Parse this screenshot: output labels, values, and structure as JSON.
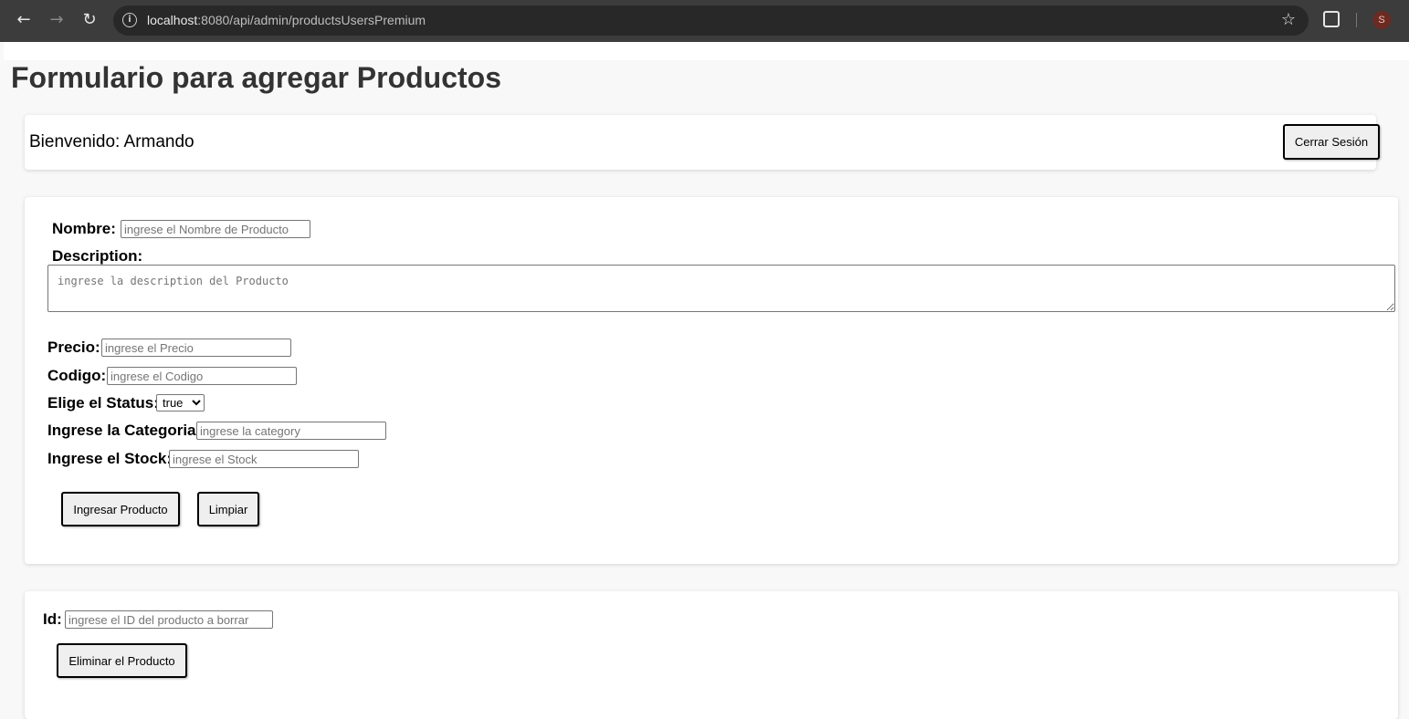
{
  "browser": {
    "url_host": "localhost",
    "url_rest": ":8080/api/admin/productsUsersPremium",
    "avatar_initial": "S"
  },
  "page": {
    "title": "Formulario para agregar Productos",
    "welcome": "Bienvenido: Armando",
    "logout_label": "Cerrar Sesión"
  },
  "form": {
    "nombre_label": "Nombre:",
    "nombre_placeholder": "ingrese el Nombre de Producto",
    "description_label": "Description:",
    "description_placeholder": "ingrese la description del Producto",
    "precio_label": "Precio:",
    "precio_placeholder": "ingrese el Precio",
    "codigo_label": "Codigo:",
    "codigo_placeholder": "ingrese el Codigo",
    "status_label": "Elige el Status:",
    "status_value": "true",
    "categoria_label": "Ingrese la Categoria:",
    "categoria_placeholder": "ingrese la category",
    "stock_label": "Ingrese el Stock:",
    "stock_placeholder": "ingrese el Stock",
    "submit_label": "Ingresar Producto",
    "clear_label": "Limpiar"
  },
  "delete": {
    "id_label": "Id:",
    "id_placeholder": "ingrese el ID del producto a borrar",
    "delete_label": "Eliminar el Producto"
  }
}
